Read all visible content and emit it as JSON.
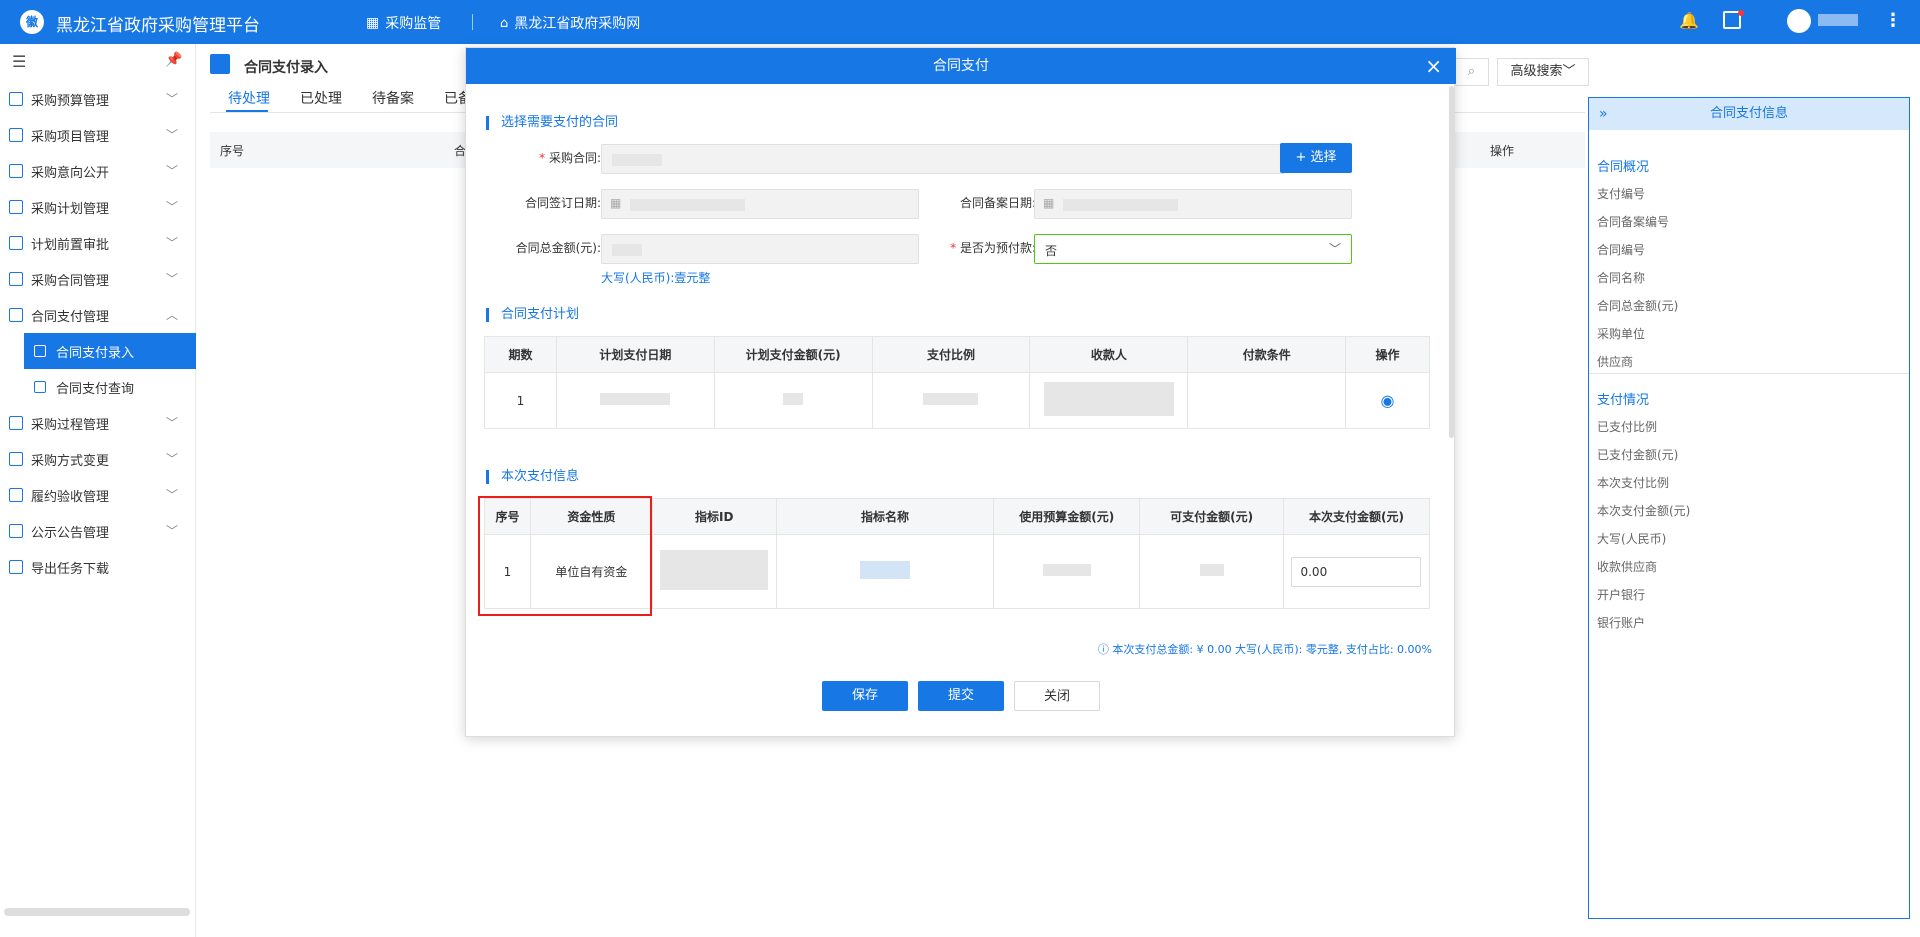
{
  "header": {
    "logo_text": "徽",
    "title": "黑龙江省政府采购管理平台",
    "nav1": "采购监管",
    "nav2": "黑龙江省政府采购网"
  },
  "sidebar": {
    "items": [
      {
        "label": "采购预算管理"
      },
      {
        "label": "采购项目管理"
      },
      {
        "label": "采购意向公开"
      },
      {
        "label": "采购计划管理"
      },
      {
        "label": "计划前置审批"
      },
      {
        "label": "采购合同管理"
      },
      {
        "label": "合同支付管理"
      },
      {
        "label": "采购过程管理"
      },
      {
        "label": "采购方式变更"
      },
      {
        "label": "履约验收管理"
      },
      {
        "label": "公示公告管理"
      },
      {
        "label": "导出任务下载"
      }
    ],
    "subitems": [
      {
        "label": "合同支付录入"
      },
      {
        "label": "合同支付查询"
      }
    ]
  },
  "main": {
    "page_title": "合同支付录入",
    "tabs": [
      "待处理",
      "已处理",
      "待备案",
      "已备"
    ],
    "col_seq": "序号",
    "col_contract": "合",
    "col_ops": "操作",
    "advanced_search": "高级搜索"
  },
  "modal": {
    "title": "合同支付",
    "close": "×",
    "section1": "选择需要支付的合同",
    "label_contract": "采购合同:",
    "select_btn": "+ 选择",
    "label_sign_date": "合同签订日期:",
    "label_filing_date": "合同备案日期:",
    "label_total": "合同总金额(元):",
    "label_prepay": "是否为预付款:",
    "prepay_value": "否",
    "capital_amount": "大写(人民币):壹元整",
    "section2": "合同支付计划",
    "plan_headers": [
      "期数",
      "计划支付日期",
      "计划支付金额(元)",
      "支付比例",
      "收款人",
      "付款条件",
      "操作"
    ],
    "plan_row": {
      "period": "1"
    },
    "section3": "本次支付信息",
    "pay_headers": [
      "序号",
      "资金性质",
      "指标ID",
      "指标名称",
      "使用预算金额(元)",
      "可支付金额(元)",
      "本次支付金额(元)"
    ],
    "pay_row": {
      "seq": "1",
      "fund_nature": "单位自有资金",
      "amount": "0.00"
    },
    "summary": "本次支付总金额: ¥ 0.00 大写(人民币): 零元整, 支付占比: 0.00%",
    "save_btn": "保存",
    "submit_btn": "提交",
    "close_btn": "关闭"
  },
  "right_panel": {
    "title": "合同支付信息",
    "sec1": "合同概况",
    "sec1_items": [
      "支付编号",
      "合同备案编号",
      "合同编号",
      "合同名称",
      "合同总金额(元)",
      "采购单位",
      "供应商"
    ],
    "sec2": "支付情况",
    "sec2_items": [
      "已支付比例",
      "已支付金额(元)",
      "本次支付比例",
      "本次支付金额(元)",
      "大写(人民币)",
      "收款供应商",
      "开户银行",
      "银行账户"
    ]
  }
}
